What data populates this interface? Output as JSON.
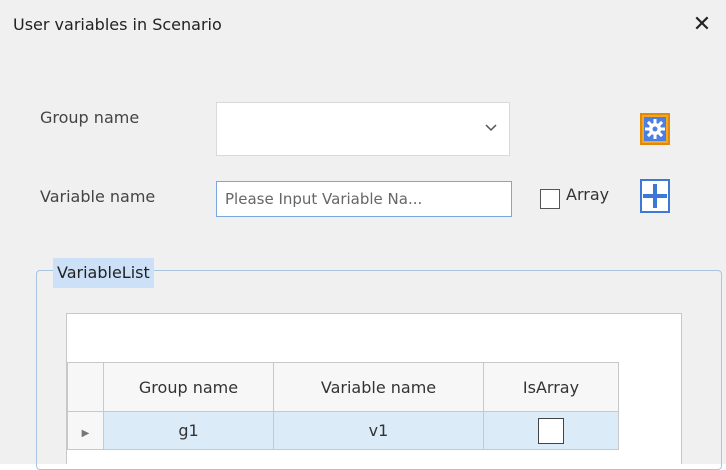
{
  "window": {
    "title": "User variables in Scenario",
    "close_glyph": "✕"
  },
  "form": {
    "group_label": "Group name",
    "group_value": "",
    "variable_label": "Variable name",
    "variable_value": "",
    "variable_placeholder": "Please Input Variable Na...",
    "array_label": "Array",
    "array_checked": false,
    "settings_icon": "gear-icon",
    "add_icon": "plus-icon"
  },
  "variable_list": {
    "legend": "VariableList",
    "columns": [
      "Group name",
      "Variable name",
      "IsArray"
    ],
    "rows": [
      {
        "group": "g1",
        "variable": "v1",
        "is_array": false,
        "selected": true
      }
    ]
  },
  "colors": {
    "accent": "#3b78d8",
    "settings_button_bg": "#f5a623",
    "selection": "#dcebf8",
    "legend_highlight": "#cce0f7"
  }
}
